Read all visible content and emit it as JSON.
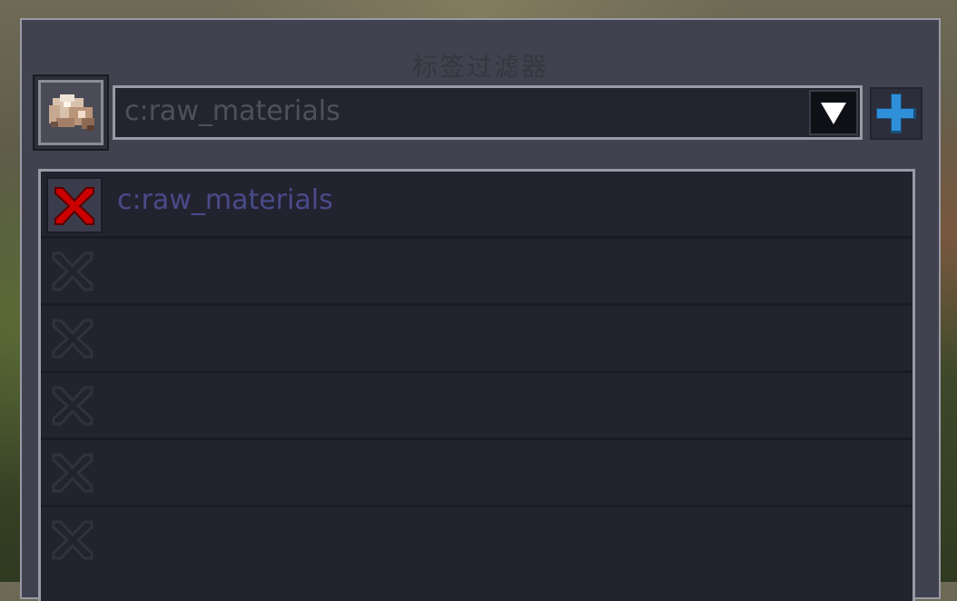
{
  "window": {
    "title": "标签过滤器"
  },
  "toolbar": {
    "item_icon": "raw-iron-icon",
    "dropdown_value": "c:raw_materials",
    "dropdown_arrow_icon": "triangle-down-icon",
    "add_icon": "plus-icon"
  },
  "filters": [
    {
      "label": "c:raw_materials",
      "active": true
    },
    {
      "label": "",
      "active": false
    },
    {
      "label": "",
      "active": false
    },
    {
      "label": "",
      "active": false
    },
    {
      "label": "",
      "active": false
    },
    {
      "label": "",
      "active": false
    }
  ],
  "colors": {
    "delete_active": "#cc0000",
    "add_accent": "#2f8fd8",
    "label_text": "#4a4a8a"
  }
}
